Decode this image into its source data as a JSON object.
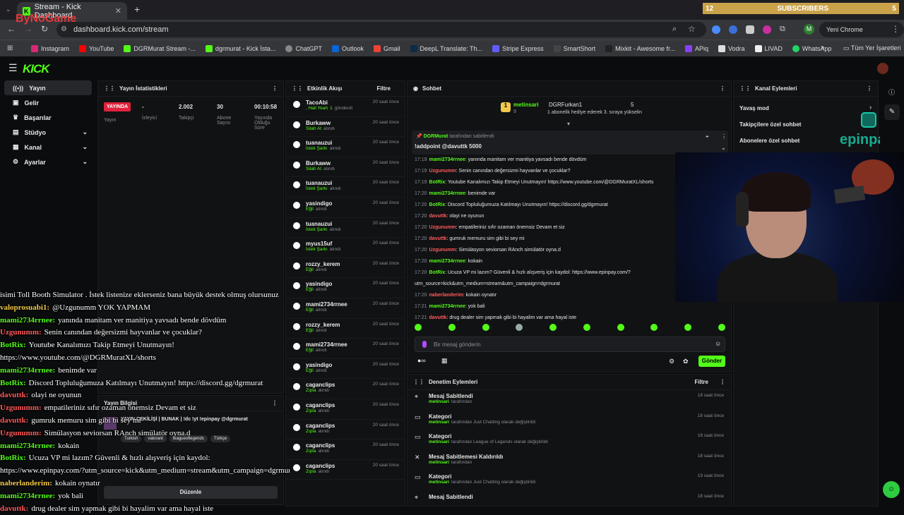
{
  "browser": {
    "tab_title": "Stream - Kick Dashboard",
    "url": "dashboard.kick.com/stream",
    "profile_button": "Yeni Chrome kullanılabilir",
    "profile_initial": "M",
    "bookmarks": [
      "Instagram",
      "YouTube",
      "DGRMurat Stream -...",
      "dgrmurat - Kick İsta...",
      "ChatGPT",
      "Outlook",
      "Gmail",
      "DeepL Translate: Th...",
      "Stripe Express",
      "SmartShort",
      "Mixkit - Awesome fr...",
      "APiq",
      "Vodra",
      "LIVAD",
      "WhatsApp"
    ],
    "all_bookmarks": "Tüm Yer İşaretleri"
  },
  "watermark": "ByNoGame",
  "subscribers_bar": {
    "left": "12",
    "label": "SUBSCRIBERS",
    "right": "5"
  },
  "app": {
    "logo": "KICK"
  },
  "sidebar": [
    {
      "label": "Yayın"
    },
    {
      "label": "Gelir"
    },
    {
      "label": "Başarılar"
    },
    {
      "label": "Stüdyo"
    },
    {
      "label": "Kanal"
    },
    {
      "label": "Ayarlar"
    }
  ],
  "stats": {
    "title": "Yayın İstatistikleri",
    "live_badge": "YAYINDA",
    "cols": [
      {
        "value": "",
        "label": "Yayın"
      },
      {
        "value": "-",
        "label": "İzleyici"
      },
      {
        "value": "2.002",
        "label": "Takipçi"
      },
      {
        "value": "30",
        "label": "Abone Sayısı"
      },
      {
        "value": "00:10:58",
        "label": "Yayında Olduğu Süre"
      }
    ]
  },
  "activity": {
    "title": "Etkinlik Akışı",
    "filter": "Filtre",
    "items": [
      {
        "name": "TacoAbi",
        "action": ", Hail Yeah",
        "extra": "1",
        "extra2": "gönderdi",
        "time": "20 saat önce"
      },
      {
        "name": "Burkaww",
        "action": "Silah At",
        "extra2": "alındı",
        "time": "20 saat önce"
      },
      {
        "name": "tuanauzui",
        "action": "İstek Şarkı",
        "extra2": "alındı",
        "time": "20 saat önce"
      },
      {
        "name": "Burkaww",
        "action": "Silah At",
        "extra2": "alındı",
        "time": "20 saat önce"
      },
      {
        "name": "tuanauzui",
        "action": "İstek Şarkı",
        "extra2": "alındı",
        "time": "20 saat önce"
      },
      {
        "name": "yasindigo",
        "action": "Eğil",
        "extra2": "alındı",
        "time": "20 saat önce"
      },
      {
        "name": "tuanauzui",
        "action": "İstek Şarkı",
        "extra2": "alındı",
        "time": "20 saat önce"
      },
      {
        "name": "myus15uf",
        "action": "İstek Şarkı",
        "extra2": "alındı",
        "time": "20 saat önce"
      },
      {
        "name": "rozzy_kerem",
        "action": "Eğil",
        "extra2": "alındı",
        "time": "20 saat önce"
      },
      {
        "name": "yasindigo",
        "action": "Eğil",
        "extra2": "alındı",
        "time": "20 saat önce"
      },
      {
        "name": "mami2734rrnee",
        "action": "Eğil",
        "extra2": "alındı",
        "time": "20 saat önce"
      },
      {
        "name": "rozzy_kerem",
        "action": "Eğil",
        "extra2": "alındı",
        "time": "20 saat önce"
      },
      {
        "name": "mami2734rrnee",
        "action": "Eğil",
        "extra2": "alındı",
        "time": "20 saat önce"
      },
      {
        "name": "yasindigo",
        "action": "Eğil",
        "extra2": "alındı",
        "time": "20 saat önce"
      },
      {
        "name": "caganclips",
        "action": "Zıpla",
        "extra2": "alındı",
        "time": "20 saat önce"
      },
      {
        "name": "caganclips",
        "action": "Zıpla",
        "extra2": "alındı",
        "time": "20 saat önce"
      },
      {
        "name": "caganclips",
        "action": "Zıpla",
        "extra2": "alındı",
        "time": "20 saat önce"
      },
      {
        "name": "caganclips",
        "action": "Zıpla",
        "extra2": "alındı",
        "time": "20 saat önce"
      },
      {
        "name": "caganclips",
        "action": "Zıpla",
        "extra2": "alındı",
        "time": "20 saat önce"
      }
    ]
  },
  "chat": {
    "title": "Sohbet",
    "gift_user": "metinsari",
    "gift_count": "9",
    "gift_target": "DGRFurkan1",
    "gift_right": "5",
    "gift_text": "1 abonelik hediye ederek 3. sıraya yükselin",
    "pinned_by": "DGRMurat",
    "pinned_by_suffix": "tarafından sabitlendi",
    "pinned_msg": "!addpoint @davuttk 5000",
    "lines": [
      {
        "time": "17:19",
        "user": "mami2734rrnee",
        "color": "#53fc18",
        "text": "yanında manitam ver manitiya yavsadı bende dövdüm"
      },
      {
        "time": "17:19",
        "user": "Uzgunumm",
        "color": "#ff5a5a",
        "text": "Senin canından değersizmi hayvanlar ve çocuklar?"
      },
      {
        "time": "17:19",
        "user": "BotRix",
        "color": "#53fc18",
        "text": "Youtube Kanalımızı Takip Etmeyi Unutmayın! https://www.youtube.com/@DGRMuratXL/shorts"
      },
      {
        "time": "17:20",
        "user": "mami2734rrnee",
        "color": "#53fc18",
        "text": "benimde var"
      },
      {
        "time": "17:20",
        "user": "BotRix",
        "color": "#53fc18",
        "text": "Discord Topluluğumuza Katılmayı Unutmayın! https://discord.gg/dgrmurat"
      },
      {
        "time": "17:20",
        "user": "davuttk",
        "color": "#ff5a5a",
        "text": "olayi ne oyunun"
      },
      {
        "time": "17:20",
        "user": "Uzgunumm",
        "color": "#ff5a5a",
        "text": "empatileriniz sıfır ozaman önemsiz Devam et siz"
      },
      {
        "time": "17:20",
        "user": "davuttk",
        "color": "#ff5a5a",
        "text": "gumruk memuru sim gibi bi sey mi"
      },
      {
        "time": "17:20",
        "user": "Uzgunumm",
        "color": "#ff5a5a",
        "text": "Simülasyon seviorsan RAnch simülatör oyna.d"
      },
      {
        "time": "17:20",
        "user": "mami2734rrnee",
        "color": "#53fc18",
        "text": "kokain"
      },
      {
        "time": "17:20",
        "user": "BotRix",
        "color": "#53fc18",
        "text": "Ucuza VP mi lazım? Güvenli & hızlı alışveriş için kaydol: https://www.epinpay.com/?"
      },
      {
        "time": "",
        "user": "",
        "color": "#fff",
        "text": "utm_source=kick&utm_medium=stream&utm_campaign=dgrmurat"
      },
      {
        "time": "17:20",
        "user": "naberlanderim",
        "color": "#ff5a5a",
        "text": "kokain oynatır"
      },
      {
        "time": "17:21",
        "user": "mami2734rrnee",
        "color": "#53fc18",
        "text": "yok bali"
      },
      {
        "time": "17:21",
        "user": "davuttk",
        "color": "#ff5a5a",
        "text": "drug dealer sim yapmak gibi bi hayalim var ama hayal iste"
      }
    ],
    "input_placeholder": "Bir mesaj gönderin",
    "send": "Gönder"
  },
  "moderation": {
    "title": "Denetim Eylemleri",
    "filter": "Filtre",
    "items": [
      {
        "title": "Mesaj Sabitlendi",
        "user": "metinsari",
        "text": "tarafından",
        "time": "18 saat önce"
      },
      {
        "title": "Kategori",
        "user": "metinsari",
        "text": "tarafından Just Chatting olarak değiştirildi",
        "time": "18 saat önce"
      },
      {
        "title": "Kategori",
        "user": "metinsari",
        "text": "tarafından League of Legends olarak değiştirildi",
        "time": "18 saat önce"
      },
      {
        "title": "Mesaj Sabitlemesi Kaldırıldı",
        "user": "metinsari",
        "text": "tarafından",
        "time": "18 saat önce"
      },
      {
        "title": "Kategori",
        "user": "metinsari",
        "text": "tarafından Just Chatting olarak değiştirildi",
        "time": "19 saat önce"
      },
      {
        "title": "Mesaj Sabitlendi",
        "user": "",
        "text": "",
        "time": "18 saat önce"
      }
    ]
  },
  "channel_actions": {
    "title": "Kanal Eylemleri",
    "items": [
      "Yavaş mod",
      "Takipçilere özel sohbet",
      "Abonelere özel sohbet"
    ],
    "brand": "epinpay"
  },
  "stream_info": {
    "title": "Yayın Bilgisi",
    "stream_title": "YAYIN ÇEKİLİŞİ | BUNAK | !dc !yt !epinpay @dgrmurat",
    "tags": [
      "Turkish",
      "valorant",
      "leagueoflegends",
      "Türkçe"
    ],
    "edit": "Düzenle"
  },
  "overlay_chat": [
    {
      "user": "",
      "color": "#fff",
      "text": "isimi Toll Booth Simulator . İstek listenize eklerseniz bana büyük destek olmuş olursunuz"
    },
    {
      "user": "valoprosuabi1:",
      "color": "#f2c84b",
      "text": "@Uzgunumm YOK YAPMAM"
    },
    {
      "user": "mami2734rrnee:",
      "color": "#53fc18",
      "text": "yanında manitam ver manitiya yavsadı bende dövdüm"
    },
    {
      "user": "Uzgunumm:",
      "color": "#ff5a5a",
      "text": "Senin canından değersizmi hayvanlar ve çocuklar?"
    },
    {
      "user": "BotRix:",
      "color": "#53fc18",
      "text": "Youtube Kanalımızı Takip Etmeyi Unutmayın!"
    },
    {
      "user": "",
      "color": "#fff",
      "text": "https://www.youtube.com/@DGRMuratXL/shorts"
    },
    {
      "user": "mami2734rrnee:",
      "color": "#53fc18",
      "text": "benimde var"
    },
    {
      "user": "BotRix:",
      "color": "#53fc18",
      "text": "Discord Topluluğumuza Katılmayı Unutmayın! https://discord.gg/dgrmurat"
    },
    {
      "user": "davuttk:",
      "color": "#ff5a5a",
      "text": "olayi ne oyunun"
    },
    {
      "user": "Uzgunumm:",
      "color": "#ff5a5a",
      "text": "empatileriniz sıfır ozaman önemsiz Devam et siz"
    },
    {
      "user": "davuttk:",
      "color": "#ff5a5a",
      "text": "gumruk memuru sim gibi bi sey mi"
    },
    {
      "user": "Uzgunumm:",
      "color": "#ff5a5a",
      "text": "Simülasyon seviorsan RAnch simülatör oyna.d"
    },
    {
      "user": "mami2734rrnee:",
      "color": "#53fc18",
      "text": "kokain"
    },
    {
      "user": "BotRix:",
      "color": "#53fc18",
      "text": "Ucuza VP mi lazım? Güvenli & hızlı alışveriş için kaydol:"
    },
    {
      "user": "",
      "color": "#fff",
      "text": "https://www.epinpay.com/?utm_source=kick&utm_medium=stream&utm_campaign=dgrmurat"
    },
    {
      "user": "naberlanderim:",
      "color": "#f2c84b",
      "text": "kokain oynatır"
    },
    {
      "user": "mami2734rrnee:",
      "color": "#53fc18",
      "text": "yok bali"
    },
    {
      "user": "davuttk:",
      "color": "#ff5a5a",
      "text": "drug dealer sim yapmak gibi bi hayalim var ama hayal iste"
    }
  ],
  "colors": {
    "accent": "#53fc18",
    "bg": "#0b0c0e",
    "panel": "#111214",
    "sub_bar": "#c9a24a",
    "live": "#e0223c"
  }
}
